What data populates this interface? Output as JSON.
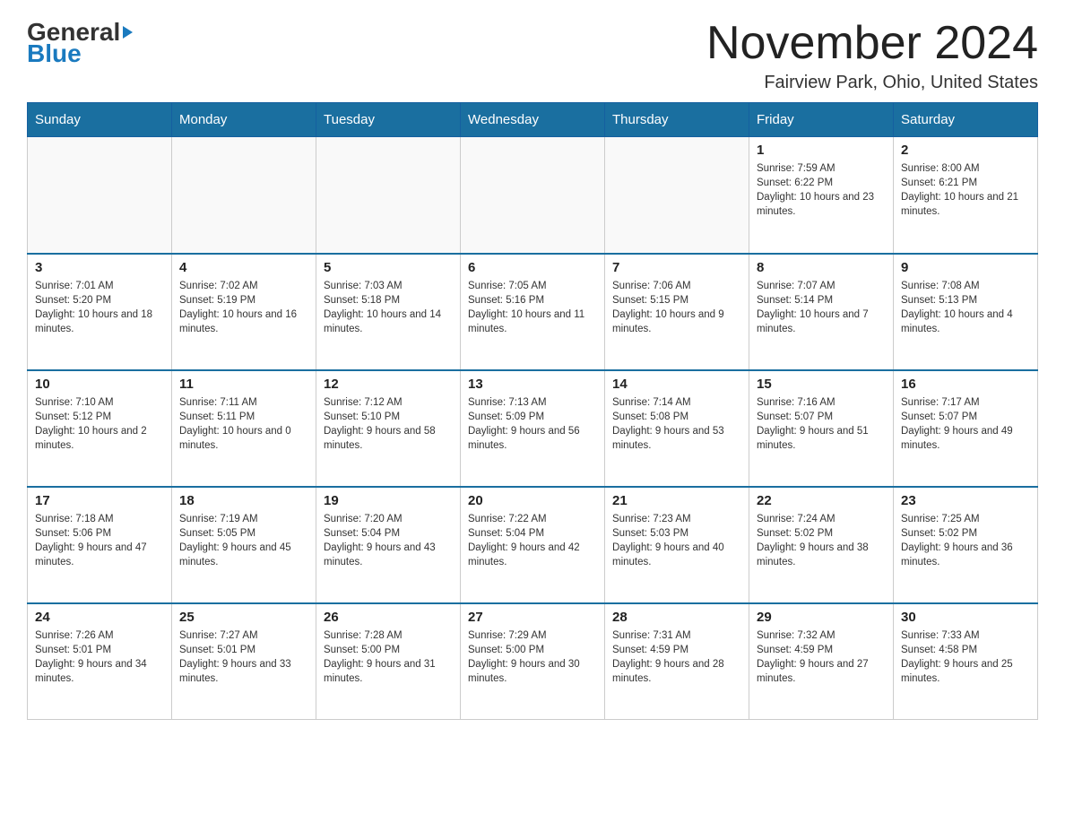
{
  "header": {
    "logo": {
      "general": "General",
      "blue": "Blue"
    },
    "title": "November 2024",
    "subtitle": "Fairview Park, Ohio, United States"
  },
  "weekdays": [
    "Sunday",
    "Monday",
    "Tuesday",
    "Wednesday",
    "Thursday",
    "Friday",
    "Saturday"
  ],
  "weeks": [
    [
      {
        "day": "",
        "sunrise": "",
        "sunset": "",
        "daylight": ""
      },
      {
        "day": "",
        "sunrise": "",
        "sunset": "",
        "daylight": ""
      },
      {
        "day": "",
        "sunrise": "",
        "sunset": "",
        "daylight": ""
      },
      {
        "day": "",
        "sunrise": "",
        "sunset": "",
        "daylight": ""
      },
      {
        "day": "",
        "sunrise": "",
        "sunset": "",
        "daylight": ""
      },
      {
        "day": "1",
        "sunrise": "Sunrise: 7:59 AM",
        "sunset": "Sunset: 6:22 PM",
        "daylight": "Daylight: 10 hours and 23 minutes."
      },
      {
        "day": "2",
        "sunrise": "Sunrise: 8:00 AM",
        "sunset": "Sunset: 6:21 PM",
        "daylight": "Daylight: 10 hours and 21 minutes."
      }
    ],
    [
      {
        "day": "3",
        "sunrise": "Sunrise: 7:01 AM",
        "sunset": "Sunset: 5:20 PM",
        "daylight": "Daylight: 10 hours and 18 minutes."
      },
      {
        "day": "4",
        "sunrise": "Sunrise: 7:02 AM",
        "sunset": "Sunset: 5:19 PM",
        "daylight": "Daylight: 10 hours and 16 minutes."
      },
      {
        "day": "5",
        "sunrise": "Sunrise: 7:03 AM",
        "sunset": "Sunset: 5:18 PM",
        "daylight": "Daylight: 10 hours and 14 minutes."
      },
      {
        "day": "6",
        "sunrise": "Sunrise: 7:05 AM",
        "sunset": "Sunset: 5:16 PM",
        "daylight": "Daylight: 10 hours and 11 minutes."
      },
      {
        "day": "7",
        "sunrise": "Sunrise: 7:06 AM",
        "sunset": "Sunset: 5:15 PM",
        "daylight": "Daylight: 10 hours and 9 minutes."
      },
      {
        "day": "8",
        "sunrise": "Sunrise: 7:07 AM",
        "sunset": "Sunset: 5:14 PM",
        "daylight": "Daylight: 10 hours and 7 minutes."
      },
      {
        "day": "9",
        "sunrise": "Sunrise: 7:08 AM",
        "sunset": "Sunset: 5:13 PM",
        "daylight": "Daylight: 10 hours and 4 minutes."
      }
    ],
    [
      {
        "day": "10",
        "sunrise": "Sunrise: 7:10 AM",
        "sunset": "Sunset: 5:12 PM",
        "daylight": "Daylight: 10 hours and 2 minutes."
      },
      {
        "day": "11",
        "sunrise": "Sunrise: 7:11 AM",
        "sunset": "Sunset: 5:11 PM",
        "daylight": "Daylight: 10 hours and 0 minutes."
      },
      {
        "day": "12",
        "sunrise": "Sunrise: 7:12 AM",
        "sunset": "Sunset: 5:10 PM",
        "daylight": "Daylight: 9 hours and 58 minutes."
      },
      {
        "day": "13",
        "sunrise": "Sunrise: 7:13 AM",
        "sunset": "Sunset: 5:09 PM",
        "daylight": "Daylight: 9 hours and 56 minutes."
      },
      {
        "day": "14",
        "sunrise": "Sunrise: 7:14 AM",
        "sunset": "Sunset: 5:08 PM",
        "daylight": "Daylight: 9 hours and 53 minutes."
      },
      {
        "day": "15",
        "sunrise": "Sunrise: 7:16 AM",
        "sunset": "Sunset: 5:07 PM",
        "daylight": "Daylight: 9 hours and 51 minutes."
      },
      {
        "day": "16",
        "sunrise": "Sunrise: 7:17 AM",
        "sunset": "Sunset: 5:07 PM",
        "daylight": "Daylight: 9 hours and 49 minutes."
      }
    ],
    [
      {
        "day": "17",
        "sunrise": "Sunrise: 7:18 AM",
        "sunset": "Sunset: 5:06 PM",
        "daylight": "Daylight: 9 hours and 47 minutes."
      },
      {
        "day": "18",
        "sunrise": "Sunrise: 7:19 AM",
        "sunset": "Sunset: 5:05 PM",
        "daylight": "Daylight: 9 hours and 45 minutes."
      },
      {
        "day": "19",
        "sunrise": "Sunrise: 7:20 AM",
        "sunset": "Sunset: 5:04 PM",
        "daylight": "Daylight: 9 hours and 43 minutes."
      },
      {
        "day": "20",
        "sunrise": "Sunrise: 7:22 AM",
        "sunset": "Sunset: 5:04 PM",
        "daylight": "Daylight: 9 hours and 42 minutes."
      },
      {
        "day": "21",
        "sunrise": "Sunrise: 7:23 AM",
        "sunset": "Sunset: 5:03 PM",
        "daylight": "Daylight: 9 hours and 40 minutes."
      },
      {
        "day": "22",
        "sunrise": "Sunrise: 7:24 AM",
        "sunset": "Sunset: 5:02 PM",
        "daylight": "Daylight: 9 hours and 38 minutes."
      },
      {
        "day": "23",
        "sunrise": "Sunrise: 7:25 AM",
        "sunset": "Sunset: 5:02 PM",
        "daylight": "Daylight: 9 hours and 36 minutes."
      }
    ],
    [
      {
        "day": "24",
        "sunrise": "Sunrise: 7:26 AM",
        "sunset": "Sunset: 5:01 PM",
        "daylight": "Daylight: 9 hours and 34 minutes."
      },
      {
        "day": "25",
        "sunrise": "Sunrise: 7:27 AM",
        "sunset": "Sunset: 5:01 PM",
        "daylight": "Daylight: 9 hours and 33 minutes."
      },
      {
        "day": "26",
        "sunrise": "Sunrise: 7:28 AM",
        "sunset": "Sunset: 5:00 PM",
        "daylight": "Daylight: 9 hours and 31 minutes."
      },
      {
        "day": "27",
        "sunrise": "Sunrise: 7:29 AM",
        "sunset": "Sunset: 5:00 PM",
        "daylight": "Daylight: 9 hours and 30 minutes."
      },
      {
        "day": "28",
        "sunrise": "Sunrise: 7:31 AM",
        "sunset": "Sunset: 4:59 PM",
        "daylight": "Daylight: 9 hours and 28 minutes."
      },
      {
        "day": "29",
        "sunrise": "Sunrise: 7:32 AM",
        "sunset": "Sunset: 4:59 PM",
        "daylight": "Daylight: 9 hours and 27 minutes."
      },
      {
        "day": "30",
        "sunrise": "Sunrise: 7:33 AM",
        "sunset": "Sunset: 4:58 PM",
        "daylight": "Daylight: 9 hours and 25 minutes."
      }
    ]
  ]
}
